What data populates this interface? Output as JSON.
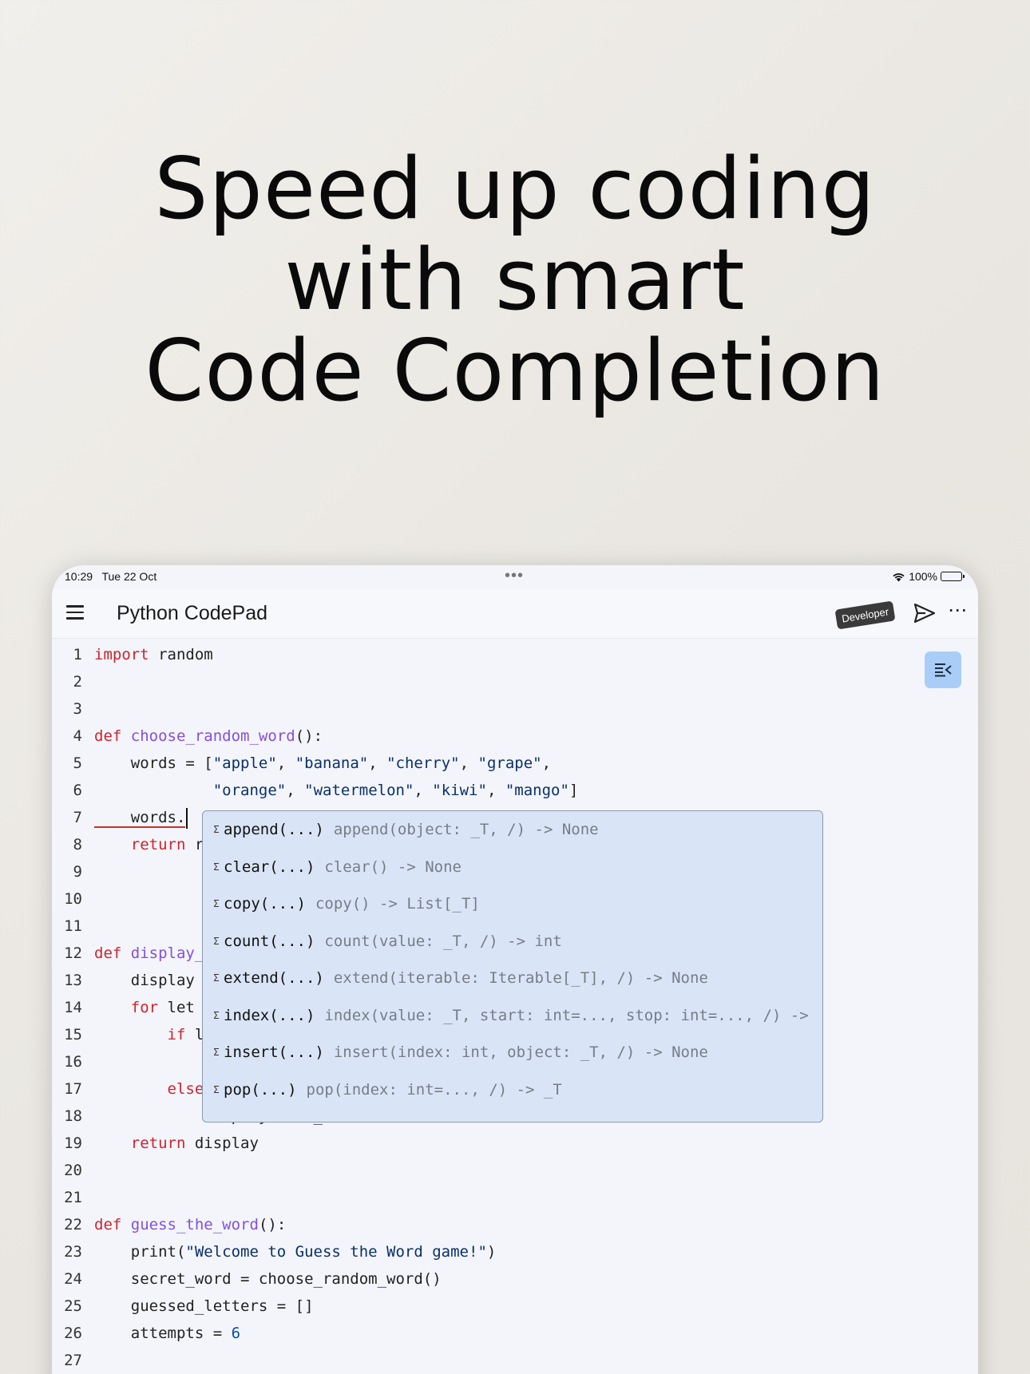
{
  "headline": {
    "line1": "Speed up coding",
    "line2": "with smart",
    "line3": "Code Completion"
  },
  "status_bar": {
    "time": "10:29",
    "date": "Tue 22 Oct",
    "battery": "100%"
  },
  "toolbar": {
    "title": "Python CodePad",
    "badge": "Developer",
    "more": "⋯"
  },
  "editor": {
    "lines": [
      {
        "n": "1",
        "parts": [
          {
            "t": "import",
            "c": "kw"
          },
          {
            "t": " random"
          }
        ]
      },
      {
        "n": "2",
        "parts": []
      },
      {
        "n": "3",
        "parts": []
      },
      {
        "n": "4",
        "parts": [
          {
            "t": "def",
            "c": "kw"
          },
          {
            "t": " "
          },
          {
            "t": "choose_random_word",
            "c": "fn"
          },
          {
            "t": "():"
          }
        ]
      },
      {
        "n": "5",
        "parts": [
          {
            "t": "    words = ["
          },
          {
            "t": "\"apple\"",
            "c": "str"
          },
          {
            "t": ", "
          },
          {
            "t": "\"banana\"",
            "c": "str"
          },
          {
            "t": ", "
          },
          {
            "t": "\"cherry\"",
            "c": "str"
          },
          {
            "t": ", "
          },
          {
            "t": "\"grape\"",
            "c": "str"
          },
          {
            "t": ","
          }
        ]
      },
      {
        "n": "6",
        "parts": [
          {
            "t": "             "
          },
          {
            "t": "\"orange\"",
            "c": "str"
          },
          {
            "t": ", "
          },
          {
            "t": "\"watermelon\"",
            "c": "str"
          },
          {
            "t": ", "
          },
          {
            "t": "\"kiwi\"",
            "c": "str"
          },
          {
            "t": ", "
          },
          {
            "t": "\"mango\"",
            "c": "str"
          },
          {
            "t": "]"
          }
        ]
      },
      {
        "n": "7",
        "parts": [
          {
            "t": "    words.",
            "c": "squiggle"
          }
        ],
        "cursor": true
      },
      {
        "n": "8",
        "parts": [
          {
            "t": "    "
          },
          {
            "t": "return",
            "c": "kw"
          },
          {
            "t": " r"
          }
        ]
      },
      {
        "n": "9",
        "parts": []
      },
      {
        "n": "10",
        "parts": []
      },
      {
        "n": "11",
        "parts": []
      },
      {
        "n": "12",
        "parts": [
          {
            "t": "def",
            "c": "kw"
          },
          {
            "t": " "
          },
          {
            "t": "display_",
            "c": "fn"
          }
        ]
      },
      {
        "n": "13",
        "parts": [
          {
            "t": "    display"
          }
        ]
      },
      {
        "n": "14",
        "parts": [
          {
            "t": "    "
          },
          {
            "t": "for",
            "c": "kw"
          },
          {
            "t": " let"
          }
        ]
      },
      {
        "n": "15",
        "parts": [
          {
            "t": "        "
          },
          {
            "t": "if",
            "c": "kw"
          },
          {
            "t": " l"
          }
        ]
      },
      {
        "n": "16",
        "parts": []
      },
      {
        "n": "17",
        "parts": [
          {
            "t": "        "
          },
          {
            "t": "else",
            "c": "kw"
          }
        ]
      },
      {
        "n": "18",
        "parts": [
          {
            "t": "            display += \"_\""
          }
        ]
      },
      {
        "n": "19",
        "parts": [
          {
            "t": "    "
          },
          {
            "t": "return",
            "c": "kw"
          },
          {
            "t": " display"
          }
        ]
      },
      {
        "n": "20",
        "parts": []
      },
      {
        "n": "21",
        "parts": []
      },
      {
        "n": "22",
        "parts": [
          {
            "t": "def",
            "c": "kw"
          },
          {
            "t": " "
          },
          {
            "t": "guess_the_word",
            "c": "fn"
          },
          {
            "t": "():"
          }
        ]
      },
      {
        "n": "23",
        "parts": [
          {
            "t": "    print("
          },
          {
            "t": "\"Welcome to Guess the Word game!\"",
            "c": "str"
          },
          {
            "t": ")"
          }
        ]
      },
      {
        "n": "24",
        "parts": [
          {
            "t": "    secret_word = choose_random_word()"
          }
        ]
      },
      {
        "n": "25",
        "parts": [
          {
            "t": "    guessed_letters = []"
          }
        ]
      },
      {
        "n": "26",
        "parts": [
          {
            "t": "    attempts = "
          },
          {
            "t": "6",
            "c": "num"
          }
        ]
      },
      {
        "n": "27",
        "parts": []
      }
    ]
  },
  "completion": {
    "items": [
      {
        "name": "append(...)",
        "detail": "append(object: _T, /) -> None"
      },
      {
        "name": "clear(...)",
        "detail": "clear() -> None"
      },
      {
        "name": "copy(...)",
        "detail": "copy() -> List[_T]"
      },
      {
        "name": "count(...)",
        "detail": "count(value: _T, /) -> int"
      },
      {
        "name": "extend(...)",
        "detail": "extend(iterable: Iterable[_T], /) -> None"
      },
      {
        "name": "index(...)",
        "detail": "index(value: _T, start: int=..., stop: int=..., /) ->"
      },
      {
        "name": "insert(...)",
        "detail": "insert(index: int, object: _T, /) -> None"
      },
      {
        "name": "pop(...)",
        "detail": "pop(index: int=..., /) -> _T"
      }
    ]
  },
  "colors": {
    "keyword": "#cf222e",
    "function": "#8250df",
    "string": "#0a3069",
    "number": "#0550ae",
    "popup_bg": "#d9e5f6",
    "outline_button": "#a9cdf7"
  }
}
